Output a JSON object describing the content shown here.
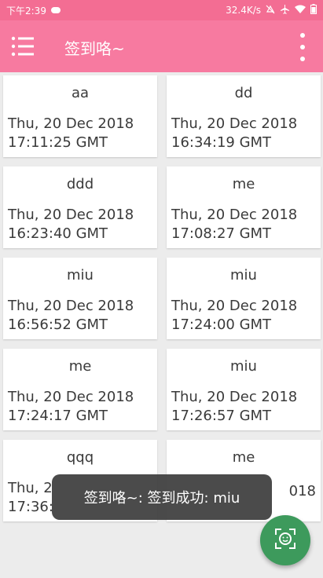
{
  "status_bar": {
    "time": "下午2:39",
    "network_speed": "32.4K/s",
    "icons": [
      "cloud-icon",
      "mute-icon",
      "airplane-icon",
      "wifi-icon",
      "battery-icon"
    ]
  },
  "app_bar": {
    "title": "签到咯~",
    "background": "#f77aa0"
  },
  "cards": [
    {
      "name": "aa",
      "date": "Thu, 20 Dec 2018\n17:11:25 GMT"
    },
    {
      "name": "dd",
      "date": "Thu, 20 Dec 2018\n16:34:19 GMT"
    },
    {
      "name": "ddd",
      "date": "Thu, 20 Dec 2018\n16:23:40 GMT"
    },
    {
      "name": "me",
      "date": "Thu, 20 Dec 2018\n17:08:27 GMT"
    },
    {
      "name": "miu",
      "date": "Thu, 20 Dec 2018\n16:56:52 GMT"
    },
    {
      "name": "miu",
      "date": "Thu, 20 Dec 2018\n17:24:00 GMT"
    },
    {
      "name": "me",
      "date": "Thu, 20 Dec 2018\n17:24:17 GMT"
    },
    {
      "name": "miu",
      "date": "Thu, 20 Dec 2018\n17:26:57 GMT"
    },
    {
      "name": "qqq",
      "date": "Thu, 2\n17:36:"
    },
    {
      "name": "me",
      "date": "018"
    }
  ],
  "toast": {
    "text": "签到咯~: 签到成功: miu"
  },
  "fab": {
    "icon": "face-scan-icon",
    "color": "#3d9a5c"
  }
}
